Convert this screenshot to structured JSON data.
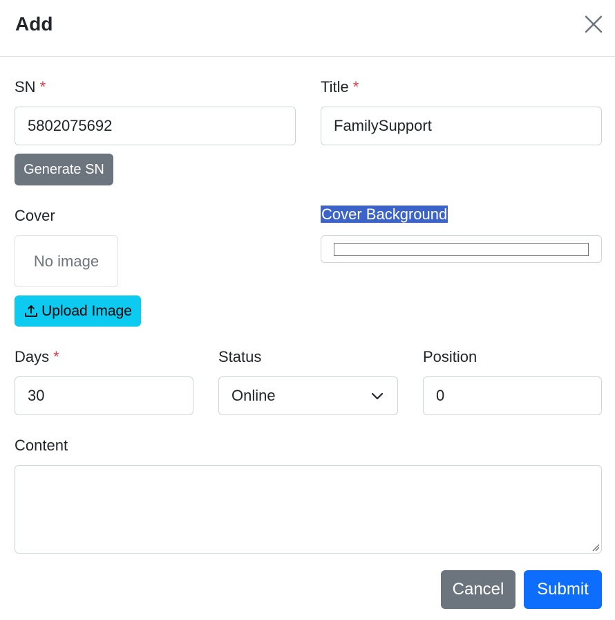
{
  "modal": {
    "title": "Add",
    "close_icon": "close-icon"
  },
  "form": {
    "sn": {
      "label": "SN",
      "required_mark": "*",
      "value": "5802075692"
    },
    "generate_sn_label": "Generate SN",
    "title": {
      "label": "Title",
      "required_mark": "*",
      "value": "FamilySupport"
    },
    "cover": {
      "label": "Cover",
      "placeholder_text": "No image",
      "upload_label": "Upload Image",
      "upload_icon": "upload-icon"
    },
    "cover_background": {
      "label": "Cover Background",
      "value": "#ffffff"
    },
    "days": {
      "label": "Days",
      "required_mark": "*",
      "value": "30"
    },
    "status": {
      "label": "Status",
      "selected": "Online",
      "icon": "chevron-down-icon"
    },
    "position": {
      "label": "Position",
      "value": "0"
    },
    "content": {
      "label": "Content",
      "value": ""
    }
  },
  "footer": {
    "cancel_label": "Cancel",
    "submit_label": "Submit"
  },
  "colors": {
    "primary": "#0d6efd",
    "secondary": "#6c757d",
    "info": "#0dcaf0",
    "danger": "#dc3545",
    "selection_highlight": "#3b63c9"
  }
}
